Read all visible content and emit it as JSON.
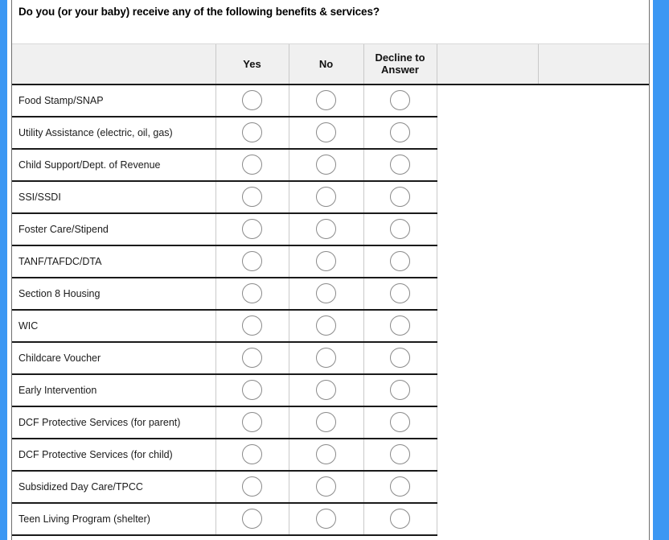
{
  "window": {
    "accent_color": "#3b97f3",
    "frame_color": "#6f6f6f"
  },
  "question": {
    "text": "Do you (or your baby) receive any of the following benefits & services?"
  },
  "table": {
    "columns": [
      {
        "key": "label",
        "label": ""
      },
      {
        "key": "yes",
        "label": "Yes"
      },
      {
        "key": "no",
        "label": "No"
      },
      {
        "key": "decline",
        "label": "Decline to Answer"
      },
      {
        "key": "extra1",
        "label": ""
      },
      {
        "key": "extra2",
        "label": ""
      }
    ],
    "header": {
      "blank_first": "",
      "yes": "Yes",
      "no": "No",
      "decline_line1": "Decline to",
      "decline_line2": "Answer",
      "blank_extra1": "",
      "blank_extra2": ""
    },
    "rows": [
      {
        "label": "Food Stamp/SNAP",
        "yes": false,
        "no": false,
        "decline": false
      },
      {
        "label": "Utility Assistance (electric, oil, gas)",
        "yes": false,
        "no": false,
        "decline": false
      },
      {
        "label": "Child Support/Dept. of Revenue",
        "yes": false,
        "no": false,
        "decline": false
      },
      {
        "label": "SSI/SSDI",
        "yes": false,
        "no": false,
        "decline": false
      },
      {
        "label": "Foster Care/Stipend",
        "yes": false,
        "no": false,
        "decline": false
      },
      {
        "label": "TANF/TAFDC/DTA",
        "yes": false,
        "no": false,
        "decline": false
      },
      {
        "label": "Section 8 Housing",
        "yes": false,
        "no": false,
        "decline": false
      },
      {
        "label": "WIC",
        "yes": false,
        "no": false,
        "decline": false
      },
      {
        "label": "Childcare Voucher",
        "yes": false,
        "no": false,
        "decline": false
      },
      {
        "label": "Early Intervention",
        "yes": false,
        "no": false,
        "decline": false
      },
      {
        "label": "DCF Protective Services (for parent)",
        "yes": false,
        "no": false,
        "decline": false
      },
      {
        "label": "DCF Protective Services (for child)",
        "yes": false,
        "no": false,
        "decline": false
      },
      {
        "label": "Subsidized Day Care/TPCC",
        "yes": false,
        "no": false,
        "decline": false
      },
      {
        "label": "Teen Living Program (shelter)",
        "yes": false,
        "no": false,
        "decline": false
      }
    ]
  }
}
